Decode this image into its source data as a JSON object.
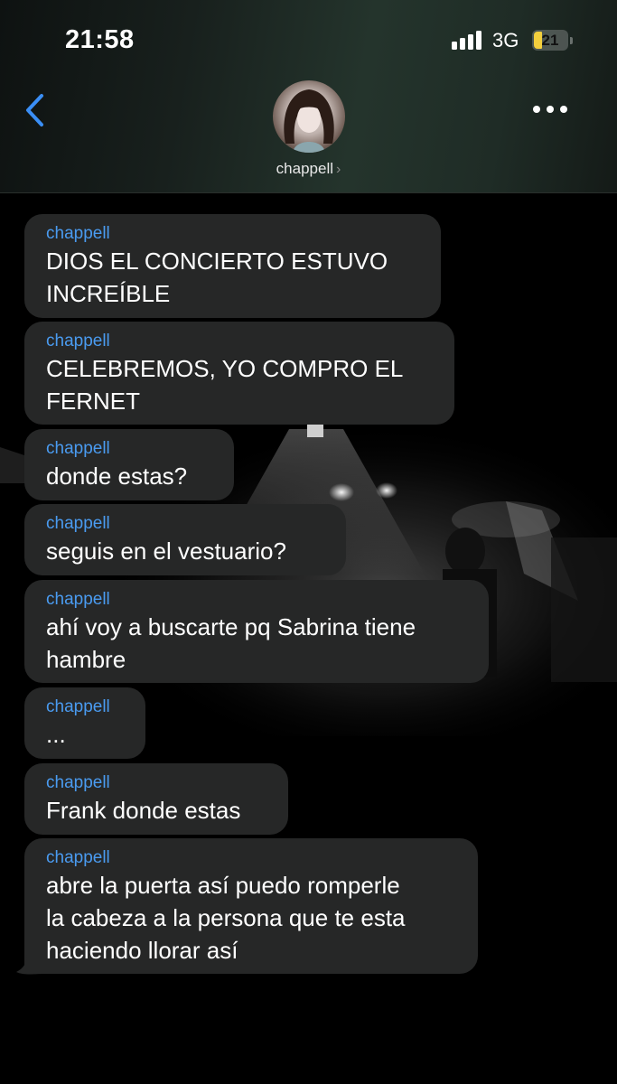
{
  "status_bar": {
    "time": "21:58",
    "network": "3G",
    "battery": "21"
  },
  "header": {
    "contact_name": "chappell",
    "name_chevron": "›"
  },
  "colors": {
    "bubble": "#262727",
    "sender": "#4a9bf0",
    "accent": "#3a8ef5",
    "battery": "#f3cf3d"
  },
  "icons": [
    "chevron-left-icon",
    "ellipsis-icon",
    "signal-icon",
    "battery-icon"
  ],
  "messages": [
    {
      "sender": "chappell",
      "text": "DIOS EL CONCIERTO ESTUVO\nINCREÍBLE"
    },
    {
      "sender": "chappell",
      "text": "CELEBREMOS, YO COMPRO EL\nFERNET"
    },
    {
      "sender": "chappell",
      "text": "donde estas?"
    },
    {
      "sender": "chappell",
      "text": "seguis en el vestuario?"
    },
    {
      "sender": "chappell",
      "text": "ahí voy a buscarte pq Sabrina tiene\nhambre"
    },
    {
      "sender": "chappell",
      "text": "..."
    },
    {
      "sender": "chappell",
      "text": "Frank donde estas"
    },
    {
      "sender": "chappell",
      "text": "abre la puerta así puedo romperle\nla cabeza a la persona que te esta\nhaciendo llorar así"
    }
  ]
}
